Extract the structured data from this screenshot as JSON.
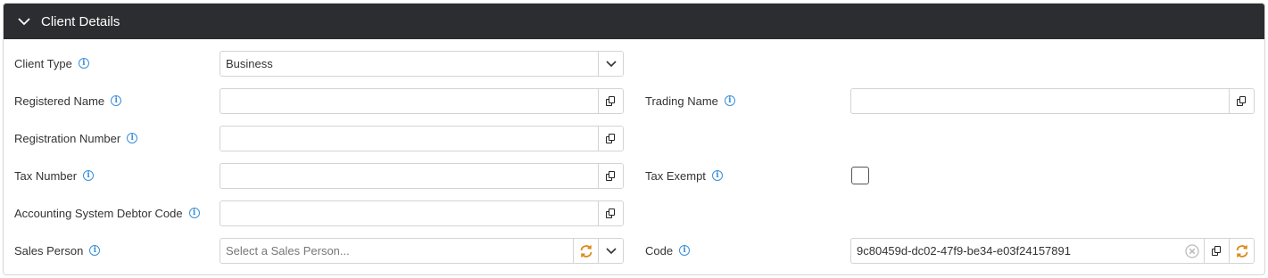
{
  "panel": {
    "title": "Client Details"
  },
  "fields": {
    "client_type": {
      "label": "Client Type",
      "value": "Business"
    },
    "registered_name": {
      "label": "Registered Name",
      "value": ""
    },
    "trading_name": {
      "label": "Trading Name",
      "value": ""
    },
    "registration_number": {
      "label": "Registration Number",
      "value": ""
    },
    "tax_number": {
      "label": "Tax Number",
      "value": ""
    },
    "tax_exempt": {
      "label": "Tax Exempt",
      "checked": false
    },
    "accounting_debtor_code": {
      "label": "Accounting System Debtor Code",
      "value": ""
    },
    "sales_person": {
      "label": "Sales Person",
      "placeholder": "Select a Sales Person..."
    },
    "code": {
      "label": "Code",
      "value": "9c80459d-dc02-47f9-be34-e03f24157891"
    }
  },
  "icons": {
    "info": "info-icon",
    "copy": "copy-icon",
    "refresh": "refresh-icon",
    "chevron": "chevron-down-icon",
    "clear": "clear-icon"
  },
  "colors": {
    "header_bg": "#2c2d30",
    "info_blue": "#3a8fd8",
    "refresh_orange": "#d98c1e"
  }
}
